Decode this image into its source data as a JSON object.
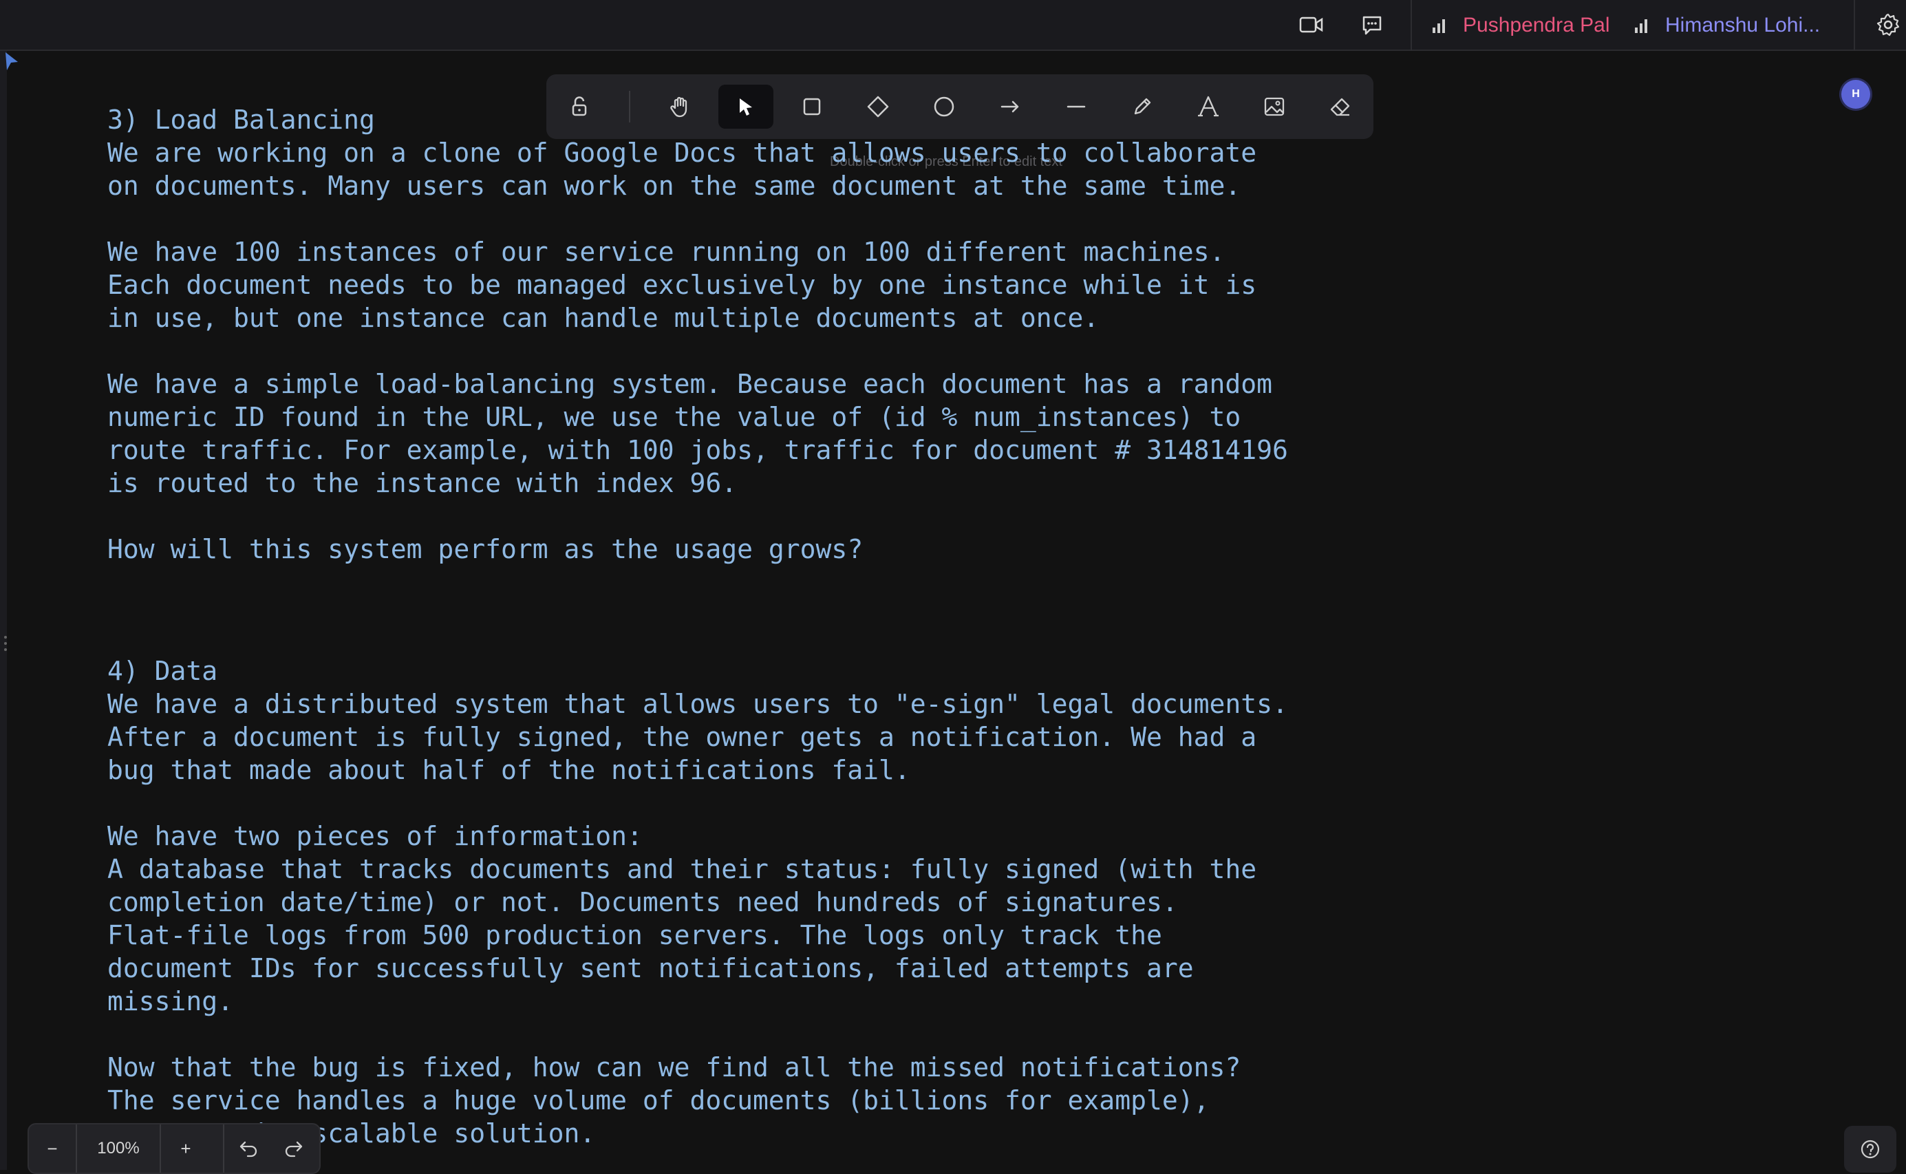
{
  "topbar": {
    "users": [
      {
        "name": "Pushpendra Pal",
        "color": "#e8567e"
      },
      {
        "name": "Himanshu Lohi...",
        "color": "#8c8ef5"
      }
    ]
  },
  "toolbar": {
    "tools": [
      "lock",
      "hand",
      "selection",
      "rectangle",
      "diamond",
      "ellipse",
      "arrow",
      "line",
      "draw",
      "text",
      "image",
      "eraser"
    ],
    "active_tool": "selection",
    "hint": "Double-click or press Enter to edit text"
  },
  "avatar": {
    "initial": "H",
    "color": "#5b64d6"
  },
  "canvas": {
    "block1": [
      "3) Load Balancing",
      "We are working on a clone of Google Docs that allows users to collaborate",
      "on documents. Many users can work on the same document at the same time.",
      "",
      "We have 100 instances of our service running on 100 different machines.",
      "Each document needs to be managed exclusively by one instance while it is",
      "in use, but one instance can handle multiple documents at once.",
      "",
      "We have a simple load-balancing system. Because each document has a random",
      "numeric ID found in the URL, we use the value of (id % num_instances) to",
      "route traffic. For example, with 100 jobs, traffic for document # 314814196",
      "is routed to the instance with index 96.",
      "",
      "How will this system perform as the usage grows?"
    ],
    "block2": [
      "4) Data",
      "We have a distributed system that allows users to \"e-sign\" legal documents.",
      "After a document is fully signed, the owner gets a notification. We had a",
      "bug that made about half of the notifications fail.",
      "",
      "We have two pieces of information:",
      "A database that tracks documents and their status: fully signed (with the",
      "completion date/time) or not. Documents need hundreds of signatures.",
      "Flat-file logs from 500 production servers. The logs only track the",
      "document IDs for successfully sent notifications, failed attempts are",
      "missing.",
      "",
      "Now that the bug is fixed, how can we find all the missed notifications?",
      "The service handles a huge volume of documents (billions for example),",
      "so we need a scalable solution."
    ]
  },
  "zoom": {
    "minus": "−",
    "level": "100%",
    "plus": "+"
  },
  "colors": {
    "text": "#8fb9e3",
    "background": "#121212",
    "accent": "#5b64d6"
  }
}
